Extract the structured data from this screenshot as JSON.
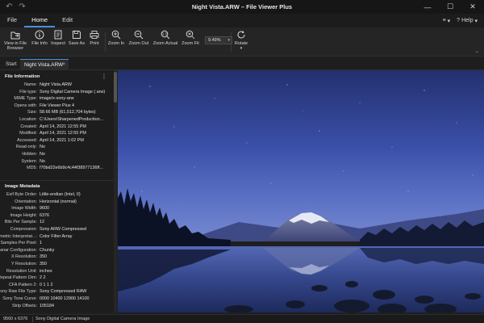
{
  "window": {
    "title": "Night Vista.ARW – File Viewer Plus",
    "undo_icon": "↶",
    "redo_icon": "↷",
    "minimize": "—",
    "maximize": "☐",
    "close": "✕"
  },
  "menu": {
    "items": [
      "File",
      "Home",
      "Edit"
    ],
    "active": "Home",
    "settings_icon": "≡",
    "help_label": "Help"
  },
  "ribbon": {
    "buttons": [
      {
        "label": "View in File\nBrowser",
        "icon": "folder-icon"
      },
      {
        "label": "File Info",
        "icon": "info-icon"
      },
      {
        "label": "Inspect",
        "icon": "inspect-icon"
      },
      {
        "label": "Save As",
        "icon": "save-icon"
      },
      {
        "label": "Print",
        "icon": "print-icon"
      },
      {
        "label": "Zoom In",
        "icon": "zoom-in-icon"
      },
      {
        "label": "Zoom Out",
        "icon": "zoom-out-icon"
      },
      {
        "label": "Zoom Actual",
        "icon": "zoom-actual-icon"
      },
      {
        "label": "Zoom Fit",
        "icon": "zoom-fit-icon"
      },
      {
        "label": "Rotate",
        "icon": "rotate-icon"
      }
    ],
    "zoom_value": "9.49%",
    "accent": "#4a8ee0"
  },
  "tabs": {
    "start": "Start",
    "file": "Night Vista.ARW",
    "close": "×"
  },
  "file_info": {
    "heading": "File Information",
    "rows": [
      {
        "k": "Name:",
        "v": "Night Vista.ARW"
      },
      {
        "k": "File type:",
        "v": "Sony Digital Camera Image (.arw)"
      },
      {
        "k": "MIME Type:",
        "v": "image/x-sony-arw"
      },
      {
        "k": "Opens with:",
        "v": "File Viewer Plus 4"
      },
      {
        "k": "Size:",
        "v": "58.66 MB (61,512,704 bytes)"
      },
      {
        "k": "Location:",
        "v": "C:\\Users\\SharpenedProduction..."
      },
      {
        "k": "Created:",
        "v": "April 14, 2021 12:55 PM"
      },
      {
        "k": "Modified:",
        "v": "April 14, 2021 12:55 PM"
      },
      {
        "k": "Accessed:",
        "v": "April 14, 2021 1:02 PM"
      },
      {
        "k": "Read-only:",
        "v": "No"
      },
      {
        "k": "Hidden:",
        "v": "No"
      },
      {
        "k": "System:",
        "v": "No"
      },
      {
        "k": "MD5:",
        "v": "f70bd22e6b9c4c44f38977136ff..."
      }
    ]
  },
  "image_metadata": {
    "heading": "Image Metadata",
    "rows": [
      {
        "k": "Exif Byte Order:",
        "v": "Little-endian (Intel, II)"
      },
      {
        "k": "Orientation:",
        "v": "Horizontal (normal)"
      },
      {
        "k": "Image Width:",
        "v": "9600"
      },
      {
        "k": "Image Height:",
        "v": "6376"
      },
      {
        "k": "Bits Per Sample:",
        "v": "12"
      },
      {
        "k": "Compression:",
        "v": "Sony ARW Compressed"
      },
      {
        "k": "Photometric Interpretat...:",
        "v": "Color Filter Array"
      },
      {
        "k": "Samples Per Pixel:",
        "v": "1"
      },
      {
        "k": "Planar Configuration:",
        "v": "Chunky"
      },
      {
        "k": "X Resolution:",
        "v": "350"
      },
      {
        "k": "Y Resolution:",
        "v": "350"
      },
      {
        "k": "Resolution Unit:",
        "v": "inches"
      },
      {
        "k": "CFA Repeat Pattern Dim:",
        "v": "2 2"
      },
      {
        "k": "CFA Pattern 2:",
        "v": "0 1 1 2"
      },
      {
        "k": "Sony Raw File Type:",
        "v": "Sony Compressed RAW"
      },
      {
        "k": "Sony Tone Curve:",
        "v": "0000 10400 12900 14100"
      },
      {
        "k": "Strip Offsets:",
        "v": "105184"
      }
    ]
  },
  "status": {
    "dimensions": "9560 x 6376",
    "type": "Sony Digital Camera Image"
  }
}
